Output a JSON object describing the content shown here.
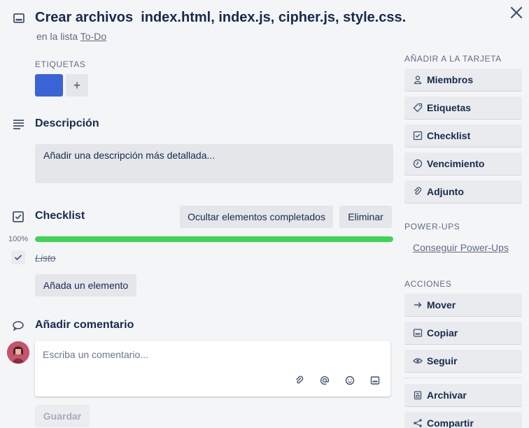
{
  "card": {
    "title": "Crear archivos  index.html, index.js, cipher.js, style.css.",
    "in_list_prefix": "en la lista",
    "list_name": "To-Do"
  },
  "labels": {
    "heading": "ETIQUETAS",
    "chip_color": "#3a63d6",
    "add_symbol": "+"
  },
  "description": {
    "heading": "Descripción",
    "placeholder": "Añadir una descripción más detallada..."
  },
  "checklist": {
    "heading": "Checklist",
    "hide_completed_label": "Ocultar elementos completados",
    "delete_label": "Eliminar",
    "progress_text": "100%",
    "progress": 1.0,
    "progress_color": "#3ed453",
    "items": [
      {
        "text": "Listo",
        "checked": true
      }
    ],
    "add_item_label": "Añada un elemento"
  },
  "comment": {
    "heading": "Añadir comentario",
    "placeholder": "Escriba un comentario...",
    "toolbar_icons": [
      "attachment-icon",
      "mention-icon",
      "emoji-icon",
      "card-icon"
    ],
    "save_label": "Guardar"
  },
  "sidebar": {
    "add_to_card_heading": "AÑADIR A LA TARJETA",
    "add_to_card": [
      {
        "label": "Miembros",
        "icon": "member-icon"
      },
      {
        "label": "Etiquetas",
        "icon": "label-icon"
      },
      {
        "label": "Checklist",
        "icon": "checklist-icon"
      },
      {
        "label": "Vencimiento",
        "icon": "clock-icon"
      },
      {
        "label": "Adjunto",
        "icon": "attachment-icon"
      }
    ],
    "powerups_heading": "POWER-UPS",
    "powerups_link": "Conseguir Power-Ups",
    "actions_heading": "ACCIONES",
    "actions": [
      {
        "label": "Mover",
        "icon": "arrow-right-icon"
      },
      {
        "label": "Copiar",
        "icon": "card-icon"
      },
      {
        "label": "Seguir",
        "icon": "eye-icon"
      },
      {
        "label": "Archivar",
        "icon": "archive-icon"
      },
      {
        "label": "Compartir",
        "icon": "share-icon"
      }
    ]
  }
}
